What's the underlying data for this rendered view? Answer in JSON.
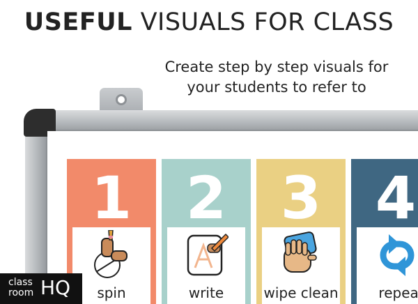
{
  "headline": {
    "bold": "USEFUL",
    "rest": " VISUALS FOR CLASS"
  },
  "subtitle": {
    "line1": "Create step by step visuals for",
    "line2": "your students to refer to"
  },
  "steps": [
    {
      "number": "1",
      "label": "spin",
      "color": "#f28a6a",
      "icon": "spin-finger-icon"
    },
    {
      "number": "2",
      "label": "write",
      "color": "#a8d1cb",
      "icon": "pencil-write-icon"
    },
    {
      "number": "3",
      "label": "wipe clean",
      "color": "#ead083",
      "icon": "hand-cloth-icon"
    },
    {
      "number": "4",
      "label": "repeat",
      "color": "#3f6782",
      "icon": "repeat-arrows-icon"
    }
  ],
  "logo": {
    "line1": "class",
    "line2": "room",
    "mark": "HQ"
  }
}
